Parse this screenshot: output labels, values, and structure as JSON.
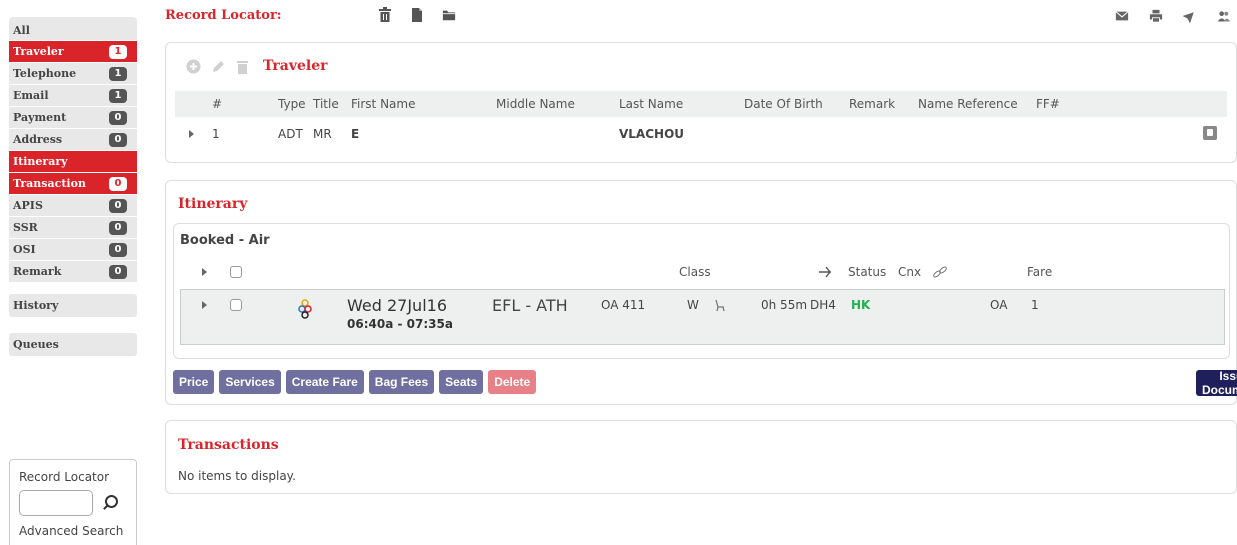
{
  "sidebar": {
    "items": [
      {
        "label": "All",
        "badge": "",
        "active": false
      },
      {
        "label": "Traveler",
        "badge": "1",
        "active": true
      },
      {
        "label": "Telephone",
        "badge": "1",
        "active": false
      },
      {
        "label": "Email",
        "badge": "1",
        "active": false
      },
      {
        "label": "Payment",
        "badge": "0",
        "active": false
      },
      {
        "label": "Address",
        "badge": "0",
        "active": false
      },
      {
        "label": "Itinerary",
        "badge": "",
        "active": true
      },
      {
        "label": "Transaction",
        "badge": "0",
        "active": true
      },
      {
        "label": "APIS",
        "badge": "0",
        "active": false
      },
      {
        "label": "SSR",
        "badge": "0",
        "active": false
      },
      {
        "label": "OSI",
        "badge": "0",
        "active": false
      },
      {
        "label": "Remark",
        "badge": "0",
        "active": false
      }
    ],
    "history": "History",
    "queues": "Queues",
    "locator_label": "Record Locator",
    "locator_value": "",
    "advanced_search": "Advanced Search"
  },
  "header": {
    "title": "Record Locator:",
    "icons": [
      "trash-icon",
      "file-icon",
      "folder-icon"
    ],
    "right_icons": [
      "mail-icon",
      "print-icon",
      "plane-icon",
      "users-icon"
    ]
  },
  "traveler": {
    "title": "Traveler",
    "columns": [
      "#",
      "Type",
      "Title",
      "First Name",
      "Middle Name",
      "Last Name",
      "Date Of Birth",
      "Remark",
      "Name Reference",
      "FF#"
    ],
    "rows": [
      {
        "num": "1",
        "type": "ADT",
        "title": "MR",
        "first": "E",
        "middle": "",
        "last": "VLACHOU",
        "dob": "",
        "remark": "",
        "nameref": "",
        "ff": ""
      }
    ]
  },
  "itinerary": {
    "title": "Itinerary",
    "booked_title": "Booked - Air",
    "columns": {
      "class": "Class",
      "status": "Status",
      "cnx": "Cnx",
      "fare": "Fare"
    },
    "segments": [
      {
        "date": "Wed 27Jul16",
        "times": "06:40a - 07:35a",
        "route": "EFL - ATH",
        "flight": "OA 411",
        "class": "W",
        "duration": "0h 55m",
        "equipment": "DH4",
        "status": "HK",
        "carrier": "OA",
        "fare": "1"
      }
    ],
    "buttons": {
      "price": "Price",
      "services": "Services",
      "create_fare": "Create Fare",
      "bag_fees": "Bag Fees",
      "seats": "Seats",
      "delete": "Delete",
      "issue": "Issue Documents"
    }
  },
  "transactions": {
    "title": "Transactions",
    "empty": "No items to display."
  },
  "colors": {
    "accent": "#d9242a",
    "button": "#7070a0",
    "issue_button": "#1f1f5c",
    "status_ok": "#22b14c"
  }
}
